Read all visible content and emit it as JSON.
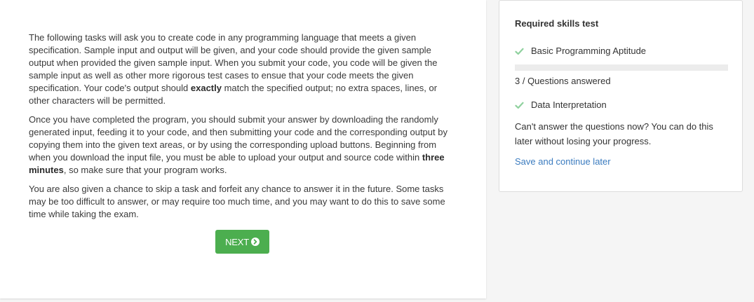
{
  "instructions": {
    "p1": {
      "a": "The following tasks will ask you to create code in any programming language that meets a given specification. Sample input and output will be given, and your code should provide the given sample output when provided the given sample input. When you submit your code, you code will be given the sample input as well as other more rigorous test cases to ensue that your code meets the given specification. Your code's output should ",
      "b": "exactly",
      "c": " match the specified output; no extra spaces, lines, or other characters will be permitted."
    },
    "p2": {
      "a": "Once you have completed the program, you should submit your answer by downloading the randomly generated input, feeding it to your code, and then submitting your code and the corresponding output by copying them into the given text areas, or by using the corresponding upload buttons. Beginning from when you download the input file, you must be able to upload your output and source code within ",
      "b": "three minutes",
      "c": ", so make sure that your program works."
    },
    "p3": "You are also given a chance to skip a task and forfeit any chance to answer it in the future. Some tasks may be too difficult to answer, or may require too much time, and you may want to do this to save some time while taking the exam."
  },
  "next_button": {
    "label": "NEXT",
    "icon": "circle-chevron-right-icon"
  },
  "sidebar": {
    "title": "Required skills test",
    "skills": [
      {
        "label": "Basic Programming Aptitude",
        "icon": "check-icon"
      },
      {
        "label": "Data Interpretation",
        "icon": "check-icon"
      }
    ],
    "progress": {
      "fraction": 0
    },
    "answered_text": "3 / Questions answered",
    "later_note": "Can't answer the questions now? You can do this later without losing your progress.",
    "later_link": "Save and continue later"
  },
  "colors": {
    "accent_green": "#4cae4f",
    "check_green": "#8fd19e",
    "link_blue": "#3a7bbf",
    "progress_track": "#ececec"
  }
}
